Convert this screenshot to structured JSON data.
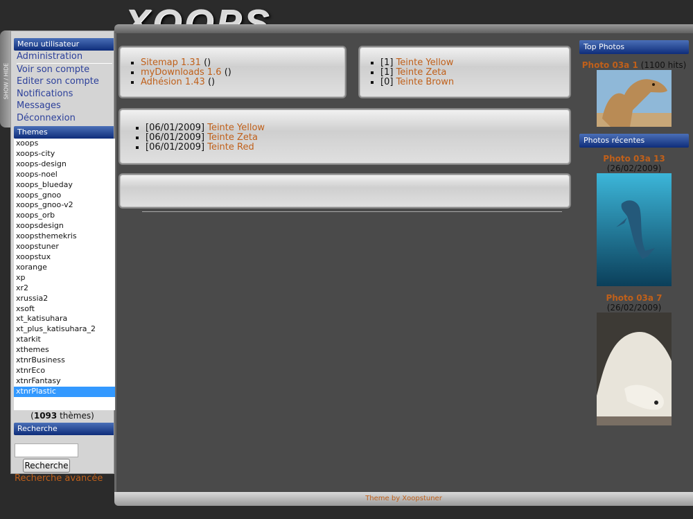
{
  "header": {
    "logo": "XOOPS"
  },
  "toggle_label": "SHOW / HIDE",
  "user_menu": {
    "title": "Menu utilisateur",
    "items": [
      "Administration",
      "Voir son compte",
      "Editer son compte",
      "Notifications",
      "Messages",
      "Déconnexion"
    ]
  },
  "themes": {
    "title": "Themes",
    "items": [
      "xoops",
      "xoops-city",
      "xoops-design",
      "xoops-noel",
      "xoops_blueday",
      "xoops_gnoo",
      "xoops_gnoo-v2",
      "xoops_orb",
      "xoopsdesign",
      "xoopsthemekris",
      "xoopstuner",
      "xoopstux",
      "xorange",
      "xp",
      "xr2",
      "xrussia2",
      "xsoft",
      "xt_katisuhara",
      "xt_plus_katisuhara_2",
      "xtarkit",
      "xthemes",
      "xtnrBusiness",
      "xtnrEco",
      "xtnrFantasy",
      "xtnrPlastic"
    ],
    "selected": "xtnrPlastic",
    "count": "1093",
    "count_suffix": "thèmes"
  },
  "search": {
    "title": "Recherche",
    "button": "Recherche",
    "advanced": "Recherche avancée"
  },
  "panel1": [
    {
      "link": "Sitemap 1.31",
      "suffix": "()"
    },
    {
      "link": "myDownloads 1.6",
      "suffix": "()"
    },
    {
      "link": "Adhésion 1.43",
      "suffix": "()"
    }
  ],
  "panel2": [
    {
      "prefix": "[1]",
      "link": "Teinte Yellow"
    },
    {
      "prefix": "[1]",
      "link": "Teinte Zeta"
    },
    {
      "prefix": "[0]",
      "link": "Teinte Brown"
    }
  ],
  "panel3": [
    {
      "prefix": "[06/01/2009]",
      "link": "Teinte Yellow"
    },
    {
      "prefix": "[06/01/2009]",
      "link": "Teinte Zeta"
    },
    {
      "prefix": "[06/01/2009]",
      "link": "Teinte Red"
    }
  ],
  "top_photos": {
    "title": "Top Photos",
    "caption_link": "Photo 03a 1",
    "caption_suffix": "(1100 hits)",
    "image": "camel"
  },
  "recent_photos": {
    "title": "Photos récentes",
    "items": [
      {
        "link": "Photo 03a 13",
        "suffix": "(26/02/2009)",
        "image": "dolphin"
      },
      {
        "link": "Photo 03a 7",
        "suffix": "(26/02/2009)",
        "image": "polar bear"
      }
    ]
  },
  "footer": {
    "credit": "Theme by Xoopstuner"
  }
}
